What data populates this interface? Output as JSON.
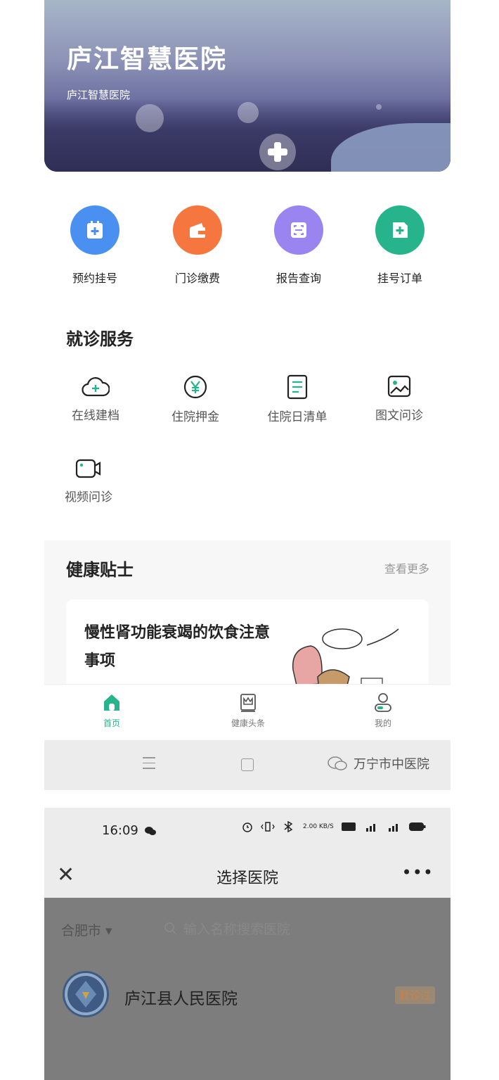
{
  "screen1": {
    "banner": {
      "title": "庐江智慧医院",
      "subtitle": "庐江智慧医院"
    },
    "quick_actions": [
      {
        "label": "预约挂号",
        "icon": "calendar-plus-icon",
        "color": "#4a90f0"
      },
      {
        "label": "门诊缴费",
        "icon": "wallet-icon",
        "color": "#f5773f"
      },
      {
        "label": "报告查询",
        "icon": "scan-report-icon",
        "color": "#9a85f0"
      },
      {
        "label": "挂号订单",
        "icon": "document-plus-icon",
        "color": "#27b48c"
      }
    ],
    "services": {
      "title": "就诊服务",
      "items": [
        {
          "label": "在线建档",
          "icon": "cloud-plus-icon"
        },
        {
          "label": "住院押金",
          "icon": "yen-icon"
        },
        {
          "label": "住院日清单",
          "icon": "list-document-icon"
        },
        {
          "label": "图文问诊",
          "icon": "image-icon"
        },
        {
          "label": "视频问诊",
          "icon": "video-camera-icon"
        }
      ]
    },
    "tips": {
      "title": "健康贴士",
      "more": "查看更多",
      "card_title": "慢性肾功能衰竭的饮食注意事项"
    },
    "tabbar": [
      {
        "label": "首页",
        "icon": "home-icon",
        "active": true
      },
      {
        "label": "健康头条",
        "icon": "crown-news-icon",
        "active": false
      },
      {
        "label": "我的",
        "icon": "user-icon",
        "active": false
      }
    ],
    "watermark": "万宁市中医院",
    "accent": "#27b48c"
  },
  "screen2": {
    "time": "16:09",
    "net_speed": "2.00 KB/S",
    "header_title": "选择医院",
    "city": "合肥市 ▾",
    "search_placeholder": "输入名称搜索医院",
    "hospital": {
      "name": "庐江县人民医院",
      "badge": "就诊过"
    }
  }
}
